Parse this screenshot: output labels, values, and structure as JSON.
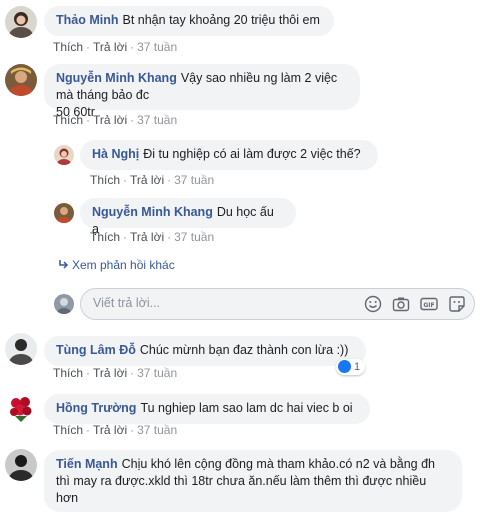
{
  "actions": {
    "like": "Thích",
    "reply": "Trả lời",
    "sep": "·"
  },
  "comments": [
    {
      "name": "Thảo Minh",
      "text": "Bt nhận tay khoảng 20 triệu thôi em",
      "time": "37 tuần"
    },
    {
      "name": "Nguyễn Minh Khang",
      "text": "Vậy sao nhiều ng làm 2 việc mà tháng bảo đc",
      "text2": "50 60tr",
      "time": "37 tuần"
    },
    {
      "name": "Hà Nghị",
      "text": "Đi tu nghiệp có ai làm được 2 việc thế?",
      "time": "37 tuần"
    },
    {
      "name": "Nguyễn Minh Khang",
      "text": "Du học ấu ạ",
      "time": "37 tuần"
    },
    {
      "name": "Tùng Lâm Đỗ",
      "text": "Chúc mừnh bạn đaz thành con lừa :))",
      "time": "37 tuần",
      "reactions": "1"
    },
    {
      "name": "Hồng Trường",
      "text": "Tu nghiep lam sao lam dc hai viec b oi",
      "time": "37 tuần"
    },
    {
      "name": "Tiến Mạnh",
      "text": "Chịu khó lên cộng đồng mà tham khảo.có n2 và bằng đh",
      "text2": "thì may ra được.xkld thì 18tr chưa ăn.nếu làm thêm thì được nhiều",
      "text3": "hơn"
    }
  ],
  "more_replies": "Xem phản hồi khác",
  "reply_input": {
    "placeholder": "Viết trả lời..."
  },
  "icons": [
    "smiley-icon",
    "camera-icon",
    "gif-icon",
    "sticker-icon",
    "reply-arrow-icon",
    "like-icon"
  ],
  "colors": {
    "name": "#385898",
    "bubble": "#f2f3f5",
    "meta": "#90949c",
    "like": "#1877f2"
  }
}
